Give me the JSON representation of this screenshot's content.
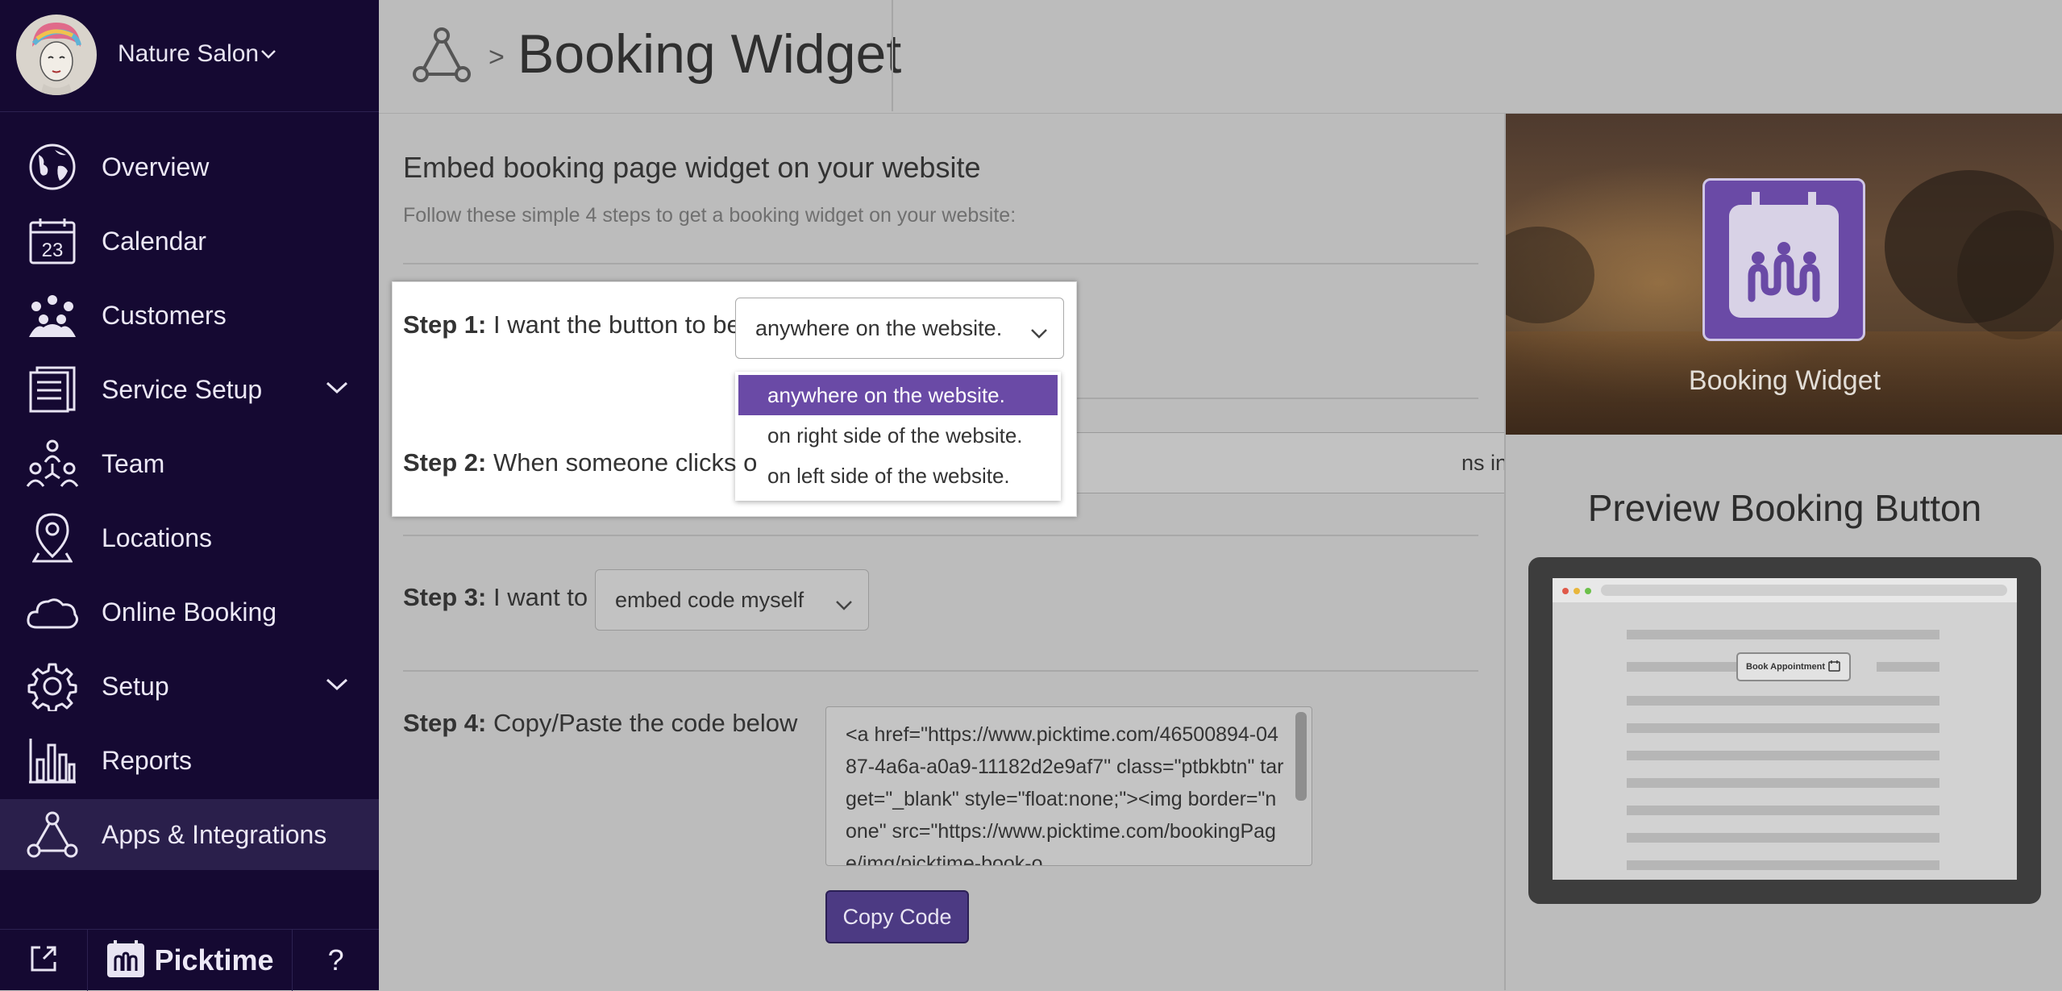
{
  "sidebar": {
    "salon_name": "Nature Salon",
    "items": [
      {
        "label": "Overview",
        "icon": "globe-icon"
      },
      {
        "label": "Calendar",
        "icon": "calendar-icon"
      },
      {
        "label": "Customers",
        "icon": "customers-icon"
      },
      {
        "label": "Service Setup",
        "icon": "services-icon",
        "has_submenu": true
      },
      {
        "label": "Team",
        "icon": "team-icon"
      },
      {
        "label": "Locations",
        "icon": "location-pin-icon"
      },
      {
        "label": "Online Booking",
        "icon": "cloud-icon"
      },
      {
        "label": "Setup",
        "icon": "gear-icon",
        "has_submenu": true
      },
      {
        "label": "Reports",
        "icon": "bar-chart-icon"
      },
      {
        "label": "Apps & Integrations",
        "icon": "integrations-icon",
        "active": true
      }
    ],
    "calendar_day": "23",
    "bottom": {
      "brand": "Picktime",
      "help": "?"
    }
  },
  "header": {
    "separator": ">",
    "title": "Booking Widget"
  },
  "main": {
    "heading": "Embed booking page widget on your website",
    "subheading": "Follow these simple 4 steps to get a booking widget on your website:",
    "step1": {
      "label": "Step 1:",
      "text": " I want the button to be",
      "value": "anywhere on the website."
    },
    "step2": {
      "label": "Step 2:",
      "text": " When someone clicks o",
      "value": "ns in new tab"
    },
    "step3": {
      "label": "Step 3:",
      "text": " I want to :",
      "value": "embed code myself"
    },
    "step4": {
      "label": "Step 4:",
      "text": " Copy/Paste the code below",
      "code": "<a href=\"https://www.picktime.com/46500894-0487-4a6a-a0a9-11182d2e9af7\" class=\"ptbkbtn\" target=\"_blank\" style=\"float:none;\"><img border=\"none\" src=\"https://www.picktime.com/bookingPage/img/picktime-book-o",
      "copy_label": "Copy Code"
    },
    "dropdown_options": [
      {
        "label": "anywhere on the website.",
        "selected": true
      },
      {
        "label": "on right side of the website.",
        "selected": false
      },
      {
        "label": "on left side of the website.",
        "selected": false
      }
    ]
  },
  "right": {
    "hero_caption": "Booking Widget",
    "preview_title": "Preview Booking Button",
    "preview_button": "Book Appointment"
  },
  "colors": {
    "sidebar_bg": "#150932",
    "accent": "#6a4aa6",
    "button": "#4c3a83"
  }
}
